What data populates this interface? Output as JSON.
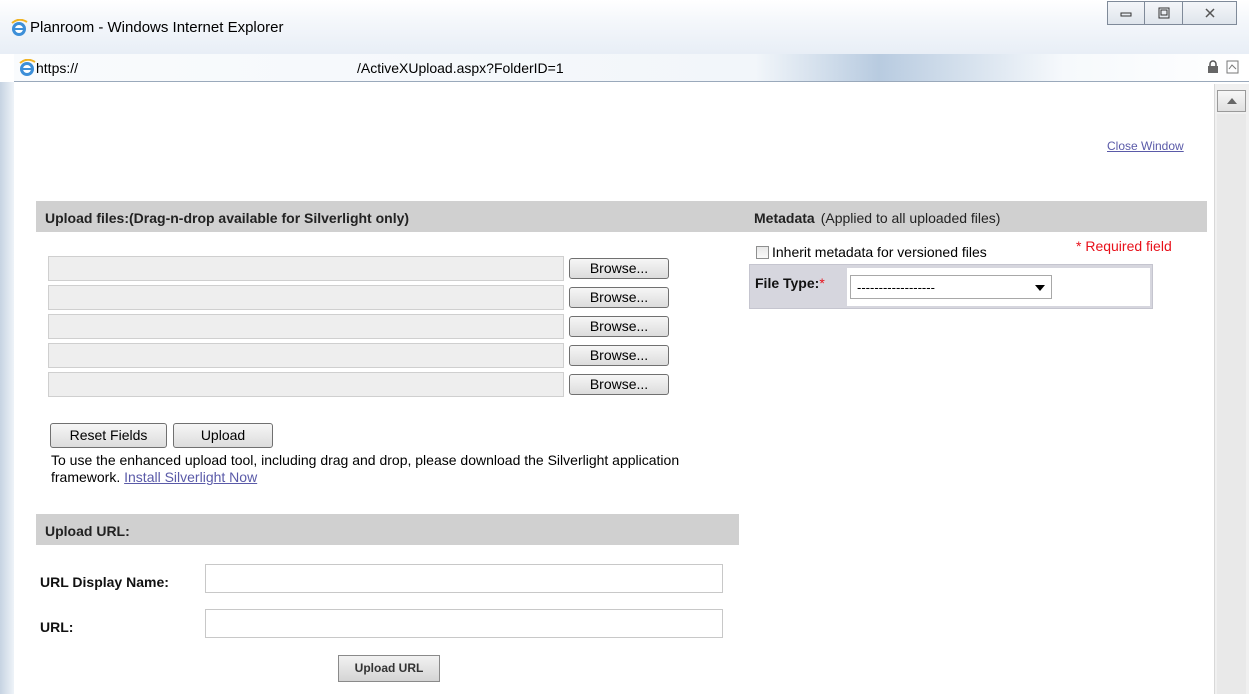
{
  "window": {
    "title": "Planroom - Windows Internet Explorer",
    "icons": [
      "ie-icon",
      "minimize-icon",
      "maximize-icon",
      "close-icon"
    ]
  },
  "address": {
    "protocol": "https://",
    "path": "/ActiveXUpload.aspx?FolderID=1"
  },
  "page": {
    "close_link": "Close Window"
  },
  "upload": {
    "header": "Upload files:(Drag-n-drop available for Silverlight only)",
    "rows": [
      {
        "button": "Browse..."
      },
      {
        "button": "Browse..."
      },
      {
        "button": "Browse..."
      },
      {
        "button": "Browse..."
      },
      {
        "button": "Browse..."
      }
    ],
    "reset_label": "Reset Fields",
    "upload_label": "Upload",
    "info_text": "To use the enhanced upload tool, including drag and drop, please download the Silverlight application framework.",
    "install_link": "Install Silverlight Now"
  },
  "upload_url": {
    "header": "Upload URL:",
    "display_name_label": "URL Display Name:",
    "url_label": "URL:",
    "button_label": "Upload URL"
  },
  "metadata": {
    "header": "Metadata",
    "subheader": "(Applied to all uploaded files)",
    "inherit_label": "Inherit metadata for versioned files",
    "required_note": "* Required field",
    "file_type_label": "File Type:",
    "required_star": "*",
    "file_type_value": "------------------"
  },
  "colors": {
    "required": "#e8101a",
    "link": "#5a5aa8",
    "section_header": "#d0d0d0"
  }
}
